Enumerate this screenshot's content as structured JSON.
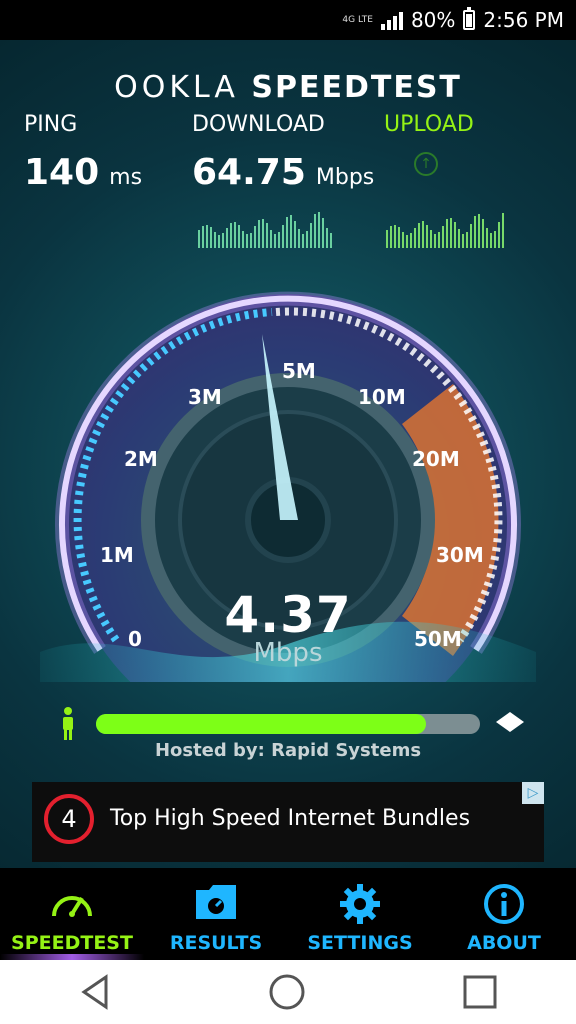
{
  "status_bar": {
    "network": "4G LTE",
    "battery": "80%",
    "time": "2:56 PM"
  },
  "app": {
    "brand_left": "OOKLA",
    "brand_right": "SPEEDTEST",
    "ping": {
      "label": "PING",
      "value": "140",
      "unit": "ms"
    },
    "download": {
      "label": "DOWNLOAD",
      "value": "64.75",
      "unit": "Mbps"
    },
    "upload": {
      "label": "UPLOAD"
    },
    "gauge": {
      "ticks": [
        "0",
        "1M",
        "2M",
        "3M",
        "5M",
        "10M",
        "20M",
        "30M",
        "50M"
      ],
      "current_value": "4.37",
      "current_unit": "Mbps"
    },
    "progress_fraction": 0.86,
    "hosted_by": "Hosted by: Rapid Systems",
    "ad": {
      "badge": "4",
      "title": "Top High Speed Internet Bundles"
    }
  },
  "nav": {
    "items": [
      {
        "label": "SPEEDTEST",
        "icon": "speedometer-icon",
        "active": true
      },
      {
        "label": "RESULTS",
        "icon": "folder-icon",
        "active": false
      },
      {
        "label": "SETTINGS",
        "icon": "gear-icon",
        "active": false
      },
      {
        "label": "ABOUT",
        "icon": "info-icon",
        "active": false
      }
    ]
  },
  "colors": {
    "accent_green": "#95f215",
    "accent_blue": "#1fb6ff",
    "gauge_orange": "#f27a2a"
  }
}
